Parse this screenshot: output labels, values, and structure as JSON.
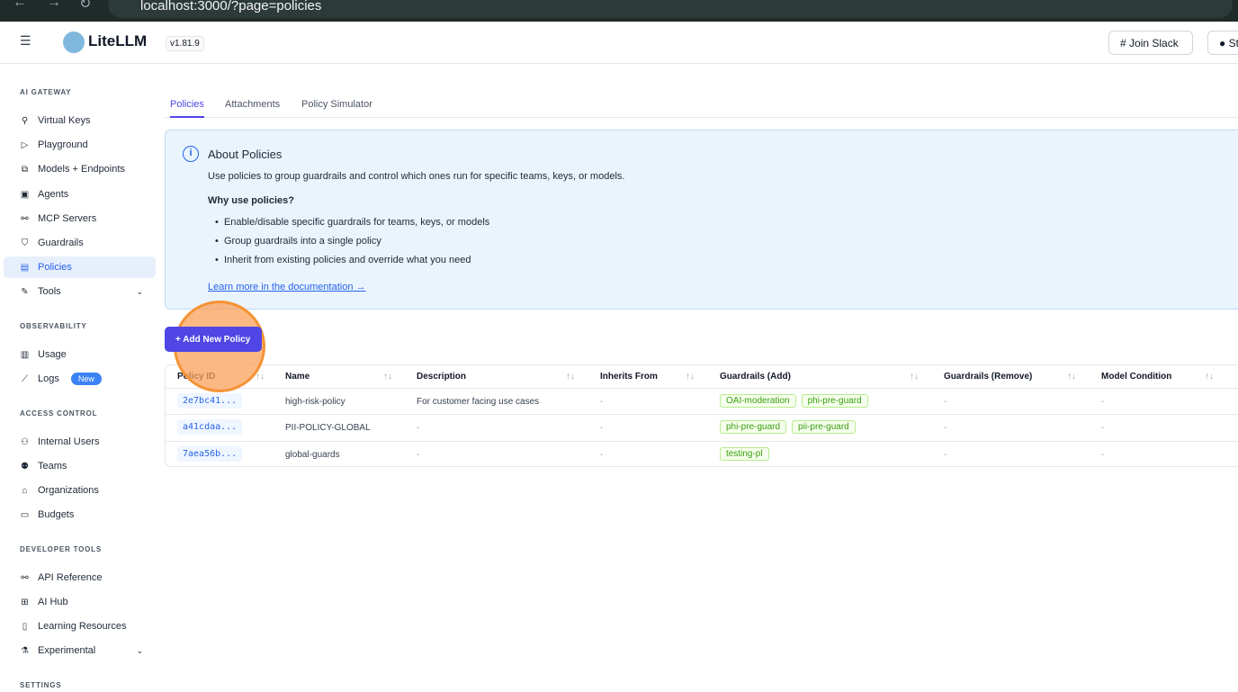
{
  "browser": {
    "url": "localhost:3000/?page=policies"
  },
  "header": {
    "app_name": "LiteLLM",
    "version": "v1.81.9",
    "join_slack": "Join Slack",
    "github": "Star"
  },
  "sidebar": {
    "sections": [
      {
        "title": "AI GATEWAY",
        "items": [
          {
            "label": "Virtual Keys"
          },
          {
            "label": "Playground"
          },
          {
            "label": "Models + Endpoints"
          },
          {
            "label": "Agents"
          },
          {
            "label": "MCP Servers"
          },
          {
            "label": "Guardrails"
          },
          {
            "label": "Policies"
          },
          {
            "label": "Tools"
          }
        ]
      },
      {
        "title": "OBSERVABILITY",
        "items": [
          {
            "label": "Usage"
          },
          {
            "label": "Logs",
            "badge": "New"
          }
        ]
      },
      {
        "title": "ACCESS CONTROL",
        "items": [
          {
            "label": "Internal Users"
          },
          {
            "label": "Teams"
          },
          {
            "label": "Organizations"
          },
          {
            "label": "Budgets"
          }
        ]
      },
      {
        "title": "DEVELOPER TOOLS",
        "items": [
          {
            "label": "API Reference"
          },
          {
            "label": "AI Hub"
          },
          {
            "label": "Learning Resources"
          },
          {
            "label": "Experimental"
          }
        ]
      },
      {
        "title": "SETTINGS",
        "items": []
      }
    ]
  },
  "tabs": [
    {
      "label": "Policies"
    },
    {
      "label": "Attachments"
    },
    {
      "label": "Policy Simulator"
    }
  ],
  "info": {
    "title": "About Policies",
    "desc": "Use policies to group guardrails and control which ones run for specific teams, keys, or models.",
    "why": "Why use policies?",
    "bullets": [
      "Enable/disable specific guardrails for teams, keys, or models",
      "Group guardrails into a single policy",
      "Inherit from existing policies and override what you need"
    ],
    "link": "Learn more in the documentation →"
  },
  "add_button": "+ Add New Policy",
  "table": {
    "headers": [
      "Policy ID",
      "Name",
      "Description",
      "Inherits From",
      "Guardrails (Add)",
      "Guardrails (Remove)",
      "Model Condition"
    ],
    "rows": [
      {
        "id": "2e7bc41...",
        "name": "high-risk-policy",
        "description": "For customer facing use cases",
        "inherits": "-",
        "add": [
          "OAI-moderation",
          "phi-pre-guard"
        ],
        "remove": "-",
        "model": "-"
      },
      {
        "id": "a41cdaa...",
        "name": "PII-POLICY-GLOBAL",
        "description": "-",
        "inherits": "-",
        "add": [
          "phi-pre-guard",
          "pii-pre-guard"
        ],
        "remove": "-",
        "model": "-"
      },
      {
        "id": "7aea56b...",
        "name": "global-guards",
        "description": "-",
        "inherits": "-",
        "add": [
          "testing-pl"
        ],
        "remove": "-",
        "model": "-"
      }
    ]
  }
}
